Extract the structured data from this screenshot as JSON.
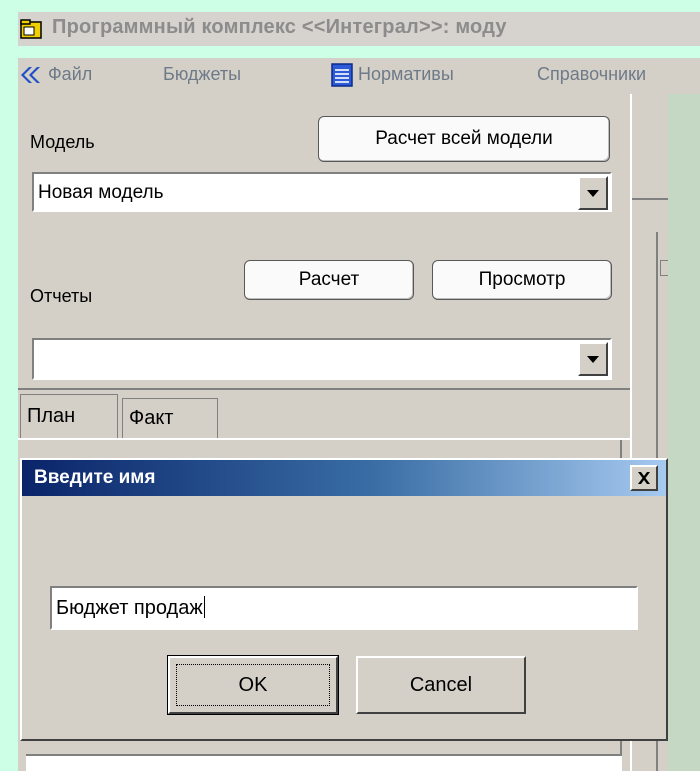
{
  "window": {
    "title": "Программный комплекс <<Интеграл>>: моду",
    "app_icon": "folder-app-icon"
  },
  "menu": {
    "back_icon": "double-chevron-left-icon",
    "items": [
      "Файл",
      "Бюджеты",
      "Нормативы",
      "Справочники"
    ],
    "normativy_icon": "document-list-icon"
  },
  "model": {
    "label": "Модель",
    "calc_all_button": "Расчет всей модели",
    "selected": "Новая модель"
  },
  "reports": {
    "label": "Отчеты",
    "calc_button": "Расчет",
    "view_button": "Просмотр",
    "selected": ""
  },
  "tabs": [
    {
      "label": "План",
      "active": true
    },
    {
      "label": "Факт",
      "active": false
    }
  ],
  "dialog": {
    "title": "Введите имя",
    "input_value": "Бюджет продаж",
    "ok_label": "OK",
    "cancel_label": "Cancel",
    "close_icon": "close-icon"
  },
  "colors": {
    "background": "#ccffe6",
    "panel": "#d4d0c8",
    "dialog_title_start": "#0a246a",
    "dialog_title_end": "#a6caf0",
    "menu_text": "#6e7a88"
  }
}
